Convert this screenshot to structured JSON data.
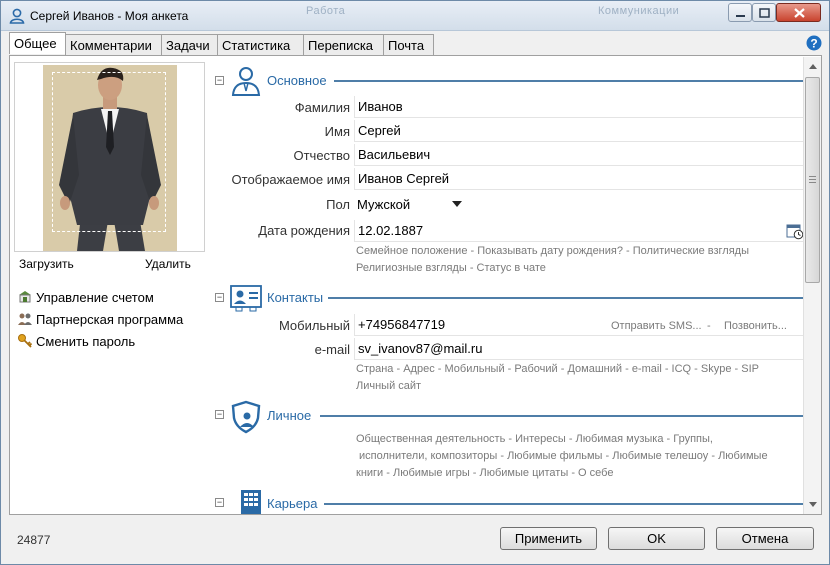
{
  "window": {
    "title": "Сергей Иванов - Моя анкета",
    "ghost_texts": [
      "Работа",
      "Коммуникации"
    ]
  },
  "tabs": [
    {
      "label": "Общее",
      "active": true
    },
    {
      "label": "Комментарии",
      "active": false
    },
    {
      "label": "Задачи",
      "active": false
    },
    {
      "label": "Статистика",
      "active": false
    },
    {
      "label": "Переписка",
      "active": false
    },
    {
      "label": "Почта",
      "active": false
    }
  ],
  "photo": {
    "upload_label": "Загрузить",
    "delete_label": "Удалить"
  },
  "left_menu": [
    {
      "label": "Управление счетом",
      "icon": "account-icon"
    },
    {
      "label": "Партнерская программа",
      "icon": "partners-icon"
    },
    {
      "label": "Сменить пароль",
      "icon": "key-icon"
    }
  ],
  "sections": {
    "basic": {
      "title": "Основное",
      "fields": {
        "last_name": {
          "label": "Фамилия",
          "value": "Иванов"
        },
        "first_name": {
          "label": "Имя",
          "value": "Сергей"
        },
        "patronymic": {
          "label": "Отчество",
          "value": "Васильевич"
        },
        "display_name": {
          "label": "Отображаемое имя",
          "value": "Иванов Сергей"
        },
        "gender": {
          "label": "Пол",
          "value": "Мужской"
        },
        "birth_date": {
          "label": "Дата рождения",
          "value": "12.02.1887"
        }
      },
      "hints_line1": [
        "Семейное положение",
        "Показывать дату рождения?",
        "Политические взгляды"
      ],
      "hints_line2": [
        "Религиозные взгляды",
        "Статус в чате"
      ]
    },
    "contacts": {
      "title": "Контакты",
      "mobile": {
        "label": "Мобильный",
        "value": "+74956847719"
      },
      "send_sms": "Отправить SMS...",
      "call": "Позвонить...",
      "email": {
        "label": "e-mail",
        "value": "sv_ivanov87@mail.ru"
      },
      "hints_line1": [
        "Страна",
        "Адрес",
        "Мобильный",
        "Рабочий",
        "Домашний",
        "e-mail",
        "ICQ",
        "Skype",
        "SIP"
      ],
      "hints_line2": [
        "Личный сайт"
      ]
    },
    "personal": {
      "title": "Личное",
      "hints_line1": [
        "Общественная деятельность",
        "Интересы",
        "Любимая музыка",
        "Группы,"
      ],
      "hints_line2": [
        "исполнители, композиторы",
        "Любимые фильмы",
        "Любимые телешоу",
        "Любимые"
      ],
      "hints_line3": [
        "книги",
        "Любимые игры",
        "Любимые цитаты",
        "О себе"
      ]
    },
    "career": {
      "title": "Карьера"
    }
  },
  "footer": {
    "id": "24877",
    "apply": "Применить",
    "ok": "OK",
    "cancel": "Отмена"
  },
  "colors": {
    "section_title": "#2a6aa6",
    "section_line": "#4f7ea8",
    "hint": "#7a7a7a"
  }
}
